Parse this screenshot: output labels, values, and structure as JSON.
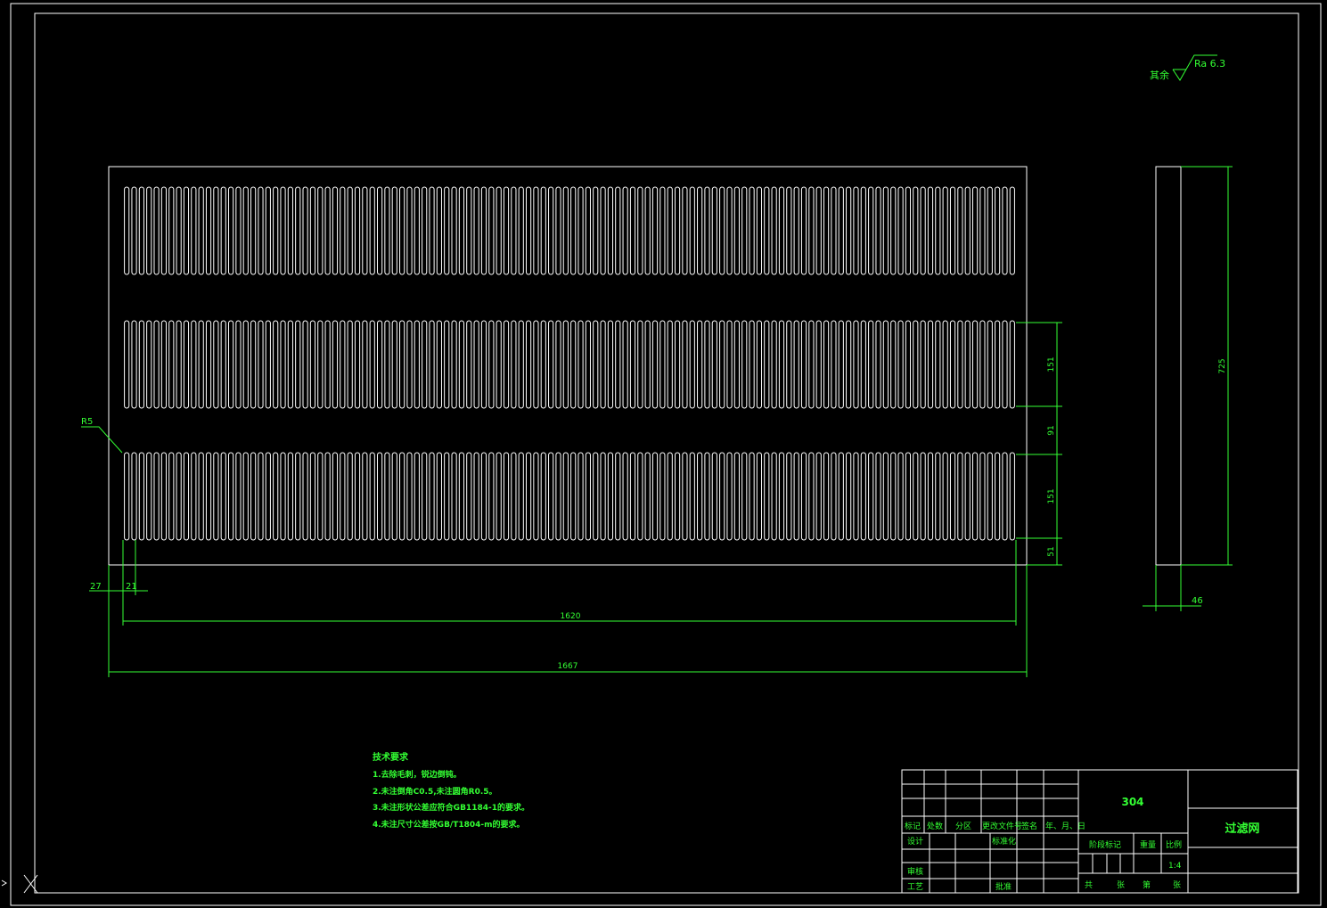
{
  "colors": {
    "background": "#000000",
    "geometry": "#ffffff",
    "annotation": "#33ff33"
  },
  "drawing": {
    "surface_finish": {
      "prefix": "其余",
      "value": "Ra 6.3"
    },
    "leader_radius": "R5",
    "slot_rows": [
      {
        "slot_count": 120
      },
      {
        "slot_count": 120
      },
      {
        "slot_count": 120
      }
    ],
    "dimensions": {
      "d27": "27",
      "d21": "21",
      "d1620": "1620",
      "d1667": "1667",
      "d151a": "151",
      "d91": "91",
      "d151b": "151",
      "d51": "51",
      "d725": "725",
      "d46": "46"
    }
  },
  "tech_requirements": {
    "title": "技术要求",
    "items": [
      "1.去除毛刺，锐边倒钝。",
      "2.未注倒角C0.5,未注圆角R0.5。",
      "3.未注形状公差应符合GB1184-1的要求。",
      "4.未注尺寸公差按GB/T1804-m的要求。"
    ]
  },
  "title_block": {
    "material": "304",
    "part_name": "过滤网",
    "headers": [
      "标记",
      "处数",
      "分区",
      "更改文件号",
      "签名",
      "年、月、日"
    ],
    "design": "设计",
    "standardize": "标准化",
    "stage_mark": "阶段标记",
    "weight": "重量",
    "scale_label": "比例",
    "scale_value": "1:4",
    "review": "审核",
    "process": "工艺",
    "approve": "批准",
    "sheets": [
      "共",
      "张",
      "第",
      "张"
    ]
  }
}
